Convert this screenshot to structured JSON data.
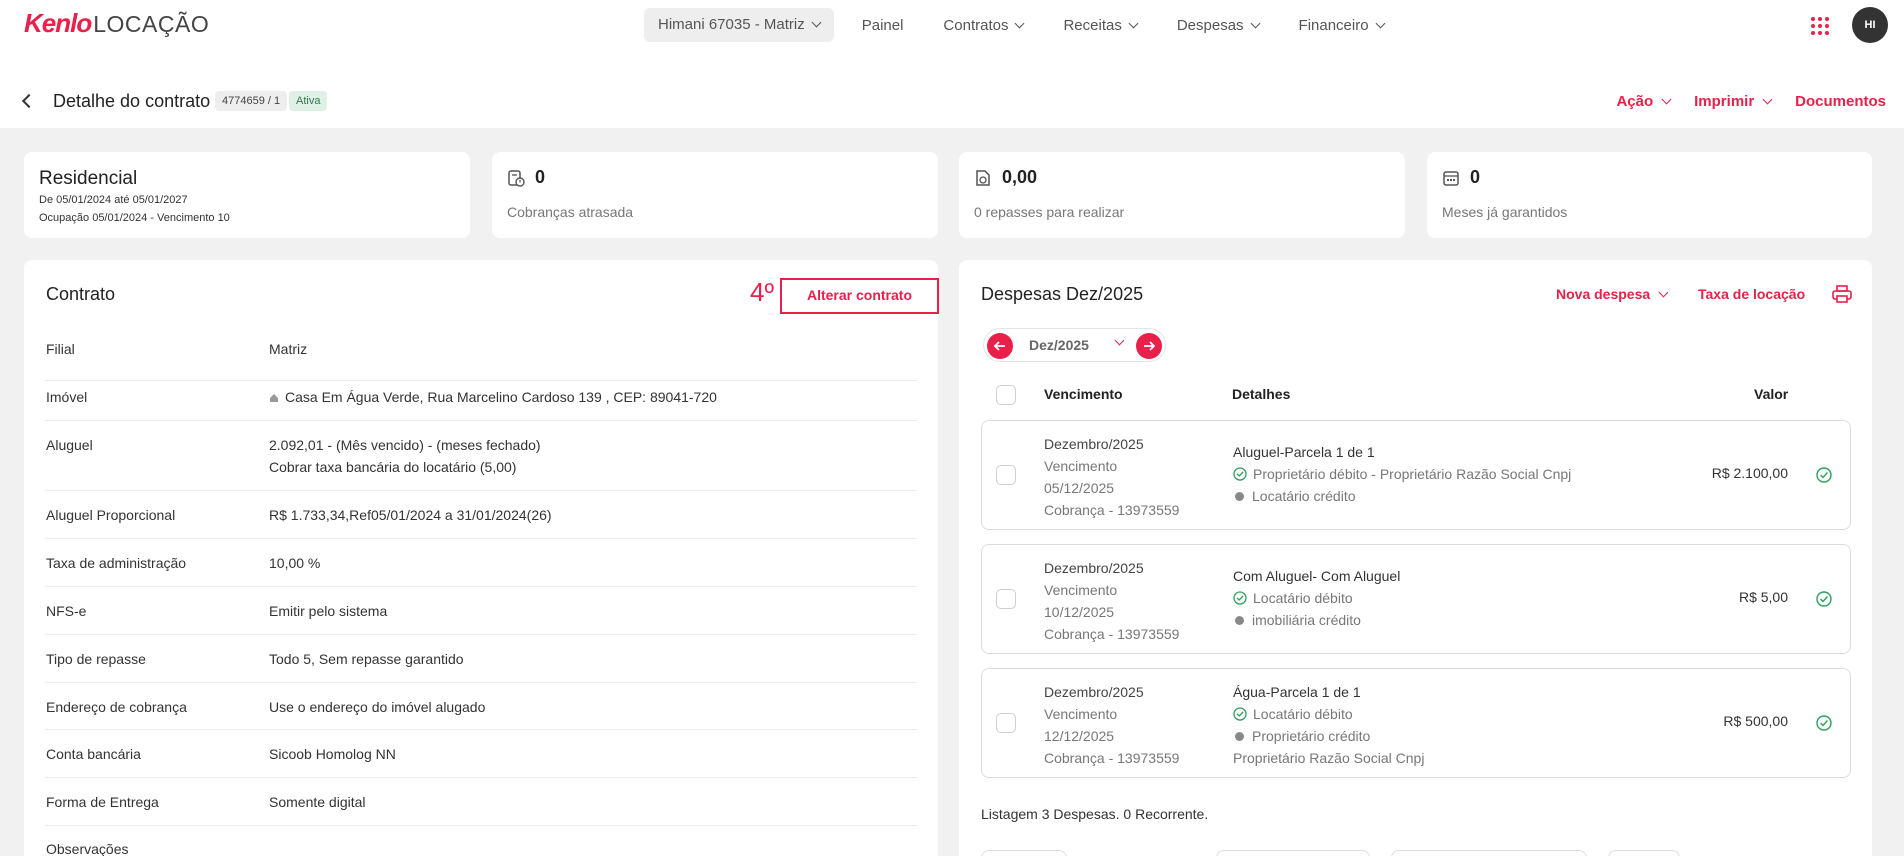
{
  "header": {
    "brand": "Kenlo",
    "product": "LOCAÇÃO",
    "branch": "Himani 67035 - Matriz",
    "nav": [
      "Painel",
      "Contratos",
      "Receitas",
      "Despesas",
      "Financeiro"
    ],
    "avatar": "HI"
  },
  "page": {
    "title": "Detalhe do contrato",
    "contract_id": "4774659 / 1",
    "status": "Ativa",
    "actions": [
      "Ação",
      "Imprimir",
      "Documentos"
    ]
  },
  "summary": {
    "type": "Residencial",
    "period": "De 05/01/2024 até 05/01/2027",
    "occupation": "Ocupação 05/01/2024 - Vencimento 10",
    "late_count": "0",
    "late_label": "Cobranças atrasada",
    "transfers_value": "0,00",
    "transfers_label": "0 repasses para realizar",
    "guaranteed_count": "0",
    "guaranteed_label": "Meses já garantidos"
  },
  "contract": {
    "title": "Contrato",
    "step": "4º",
    "edit_label": "Alterar contrato",
    "rows": [
      {
        "label": "Filial",
        "value": "Matriz"
      },
      {
        "label": "Imóvel",
        "value": "Casa Em Água Verde, Rua Marcelino Cardoso 139 , CEP: 89041-720"
      },
      {
        "label": "Aluguel",
        "value": "2.092,01 - (Mês vencido) - (meses fechado)",
        "value2": "Cobrar taxa bancária do locatário (5,00)"
      },
      {
        "label": "Aluguel Proporcional",
        "value": "R$ 1.733,34,Ref05/01/2024 a 31/01/2024(26)"
      },
      {
        "label": "Taxa de administração",
        "value": "10,00 %"
      },
      {
        "label": "NFS-e",
        "value": "Emitir pelo sistema"
      },
      {
        "label": "Tipo de repasse",
        "value": "Todo 5, Sem repasse garantido"
      },
      {
        "label": "Endereço de cobrança",
        "value": "Use o endereço do imóvel alugado"
      },
      {
        "label": "Conta bancária",
        "value": "Sicoob Homolog NN"
      },
      {
        "label": "Forma de Entrega",
        "value": "Somente digital"
      },
      {
        "label": "Observações",
        "value": ""
      }
    ]
  },
  "expenses": {
    "title": "Despesas Dez/2025",
    "new_label": "Nova despesa",
    "fee_label": "Taxa de locação",
    "month": "Dez/2025",
    "columns": [
      "Vencimento",
      "Detalhes",
      "Valor"
    ],
    "items": [
      {
        "month": "Dezembro/2025",
        "due_label": "Vencimento",
        "due_date": "05/12/2025",
        "charge": "Cobrança - 13973559",
        "title": "Aluguel-Parcela 1 de 1",
        "line1": "Proprietário débito - Proprietário Razão Social Cnpj",
        "line2": "Locatário crédito",
        "line3": "",
        "amount": "R$ 2.100,00"
      },
      {
        "month": "Dezembro/2025",
        "due_label": "Vencimento",
        "due_date": "10/12/2025",
        "charge": "Cobrança - 13973559",
        "title": "Com Aluguel- Com Aluguel",
        "line1": "Locatário débito",
        "line2": "imobiliária crédito",
        "line3": "",
        "amount": "R$ 5,00"
      },
      {
        "month": "Dezembro/2025",
        "due_label": "Vencimento",
        "due_date": "12/12/2025",
        "charge": "Cobrança - 13973559",
        "title": "Água-Parcela 1 de 1",
        "line1": "Locatário débito",
        "line2": "Proprietário crédito",
        "line3": "Proprietário Razão Social Cnpj",
        "amount": "R$ 500,00"
      }
    ],
    "listing": "Listagem 3 Despesas. 0 Recorrente."
  },
  "colors": {
    "accent": "#e8204a",
    "success": "#2f9e5b"
  }
}
